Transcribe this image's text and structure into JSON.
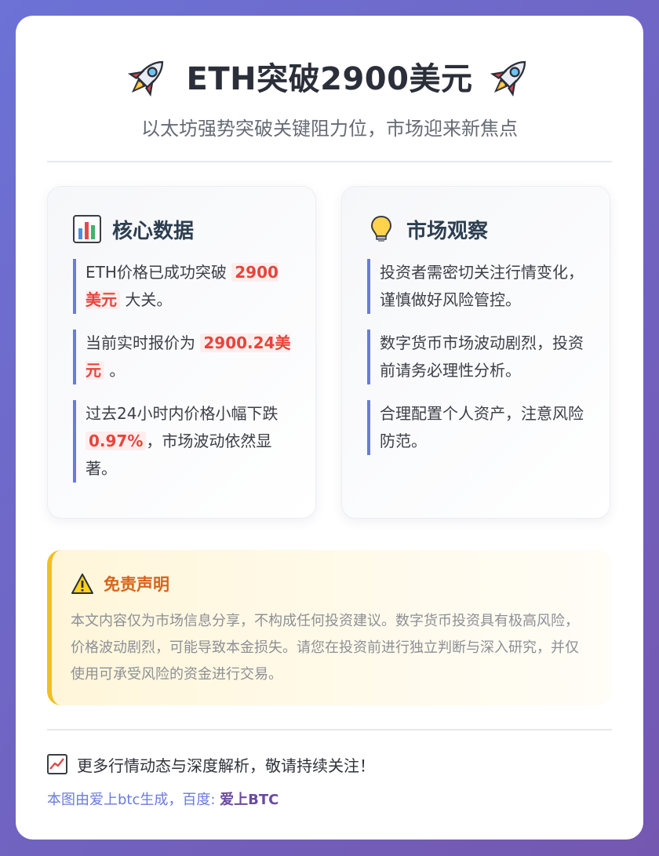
{
  "header": {
    "title": "ETH突破2900美元",
    "subtitle": "以太坊强势突破关键阻力位，市场迎来新焦点",
    "left_icon": "rocket-icon",
    "right_icon": "rocket-icon"
  },
  "core": {
    "title": "核心数据",
    "icon": "bar-chart-icon",
    "items": [
      {
        "pre": "ETH价格已成功突破 ",
        "highlight": "2900美元",
        "post": " 大关。"
      },
      {
        "pre": "当前实时报价为 ",
        "highlight": "2900.24美元",
        "post": " 。"
      },
      {
        "pre": "过去24小时内价格小幅下跌 ",
        "highlight": "0.97%",
        "post": "，市场波动依然显著。"
      }
    ]
  },
  "market": {
    "title": "市场观察",
    "icon": "lightbulb-icon",
    "items": [
      "投资者需密切关注行情变化，谨慎做好风险管控。",
      "数字货币市场波动剧烈，投资前请务必理性分析。",
      "合理配置个人资产，注意风险防范。"
    ]
  },
  "disclaimer": {
    "title": "免责声明",
    "icon": "warning-icon",
    "text": "本文内容仅为市场信息分享，不构成任何投资建议。数字货币投资具有极高风险，价格波动剧烈，可能导致本金损失。请您在投资前进行独立判断与深入研究，并仅使用可承受风险的资金进行交易。"
  },
  "footer": {
    "follow_icon": "trend-up-icon",
    "follow_text": "更多行情动态与深度解析，敬请持续关注！",
    "credit_text": "本图由爱上btc生成，百度: ",
    "credit_link": "爱上BTC"
  },
  "colors": {
    "accent": "#6a7bdc",
    "highlight": "#e5453c",
    "warning": "#d7641b"
  }
}
